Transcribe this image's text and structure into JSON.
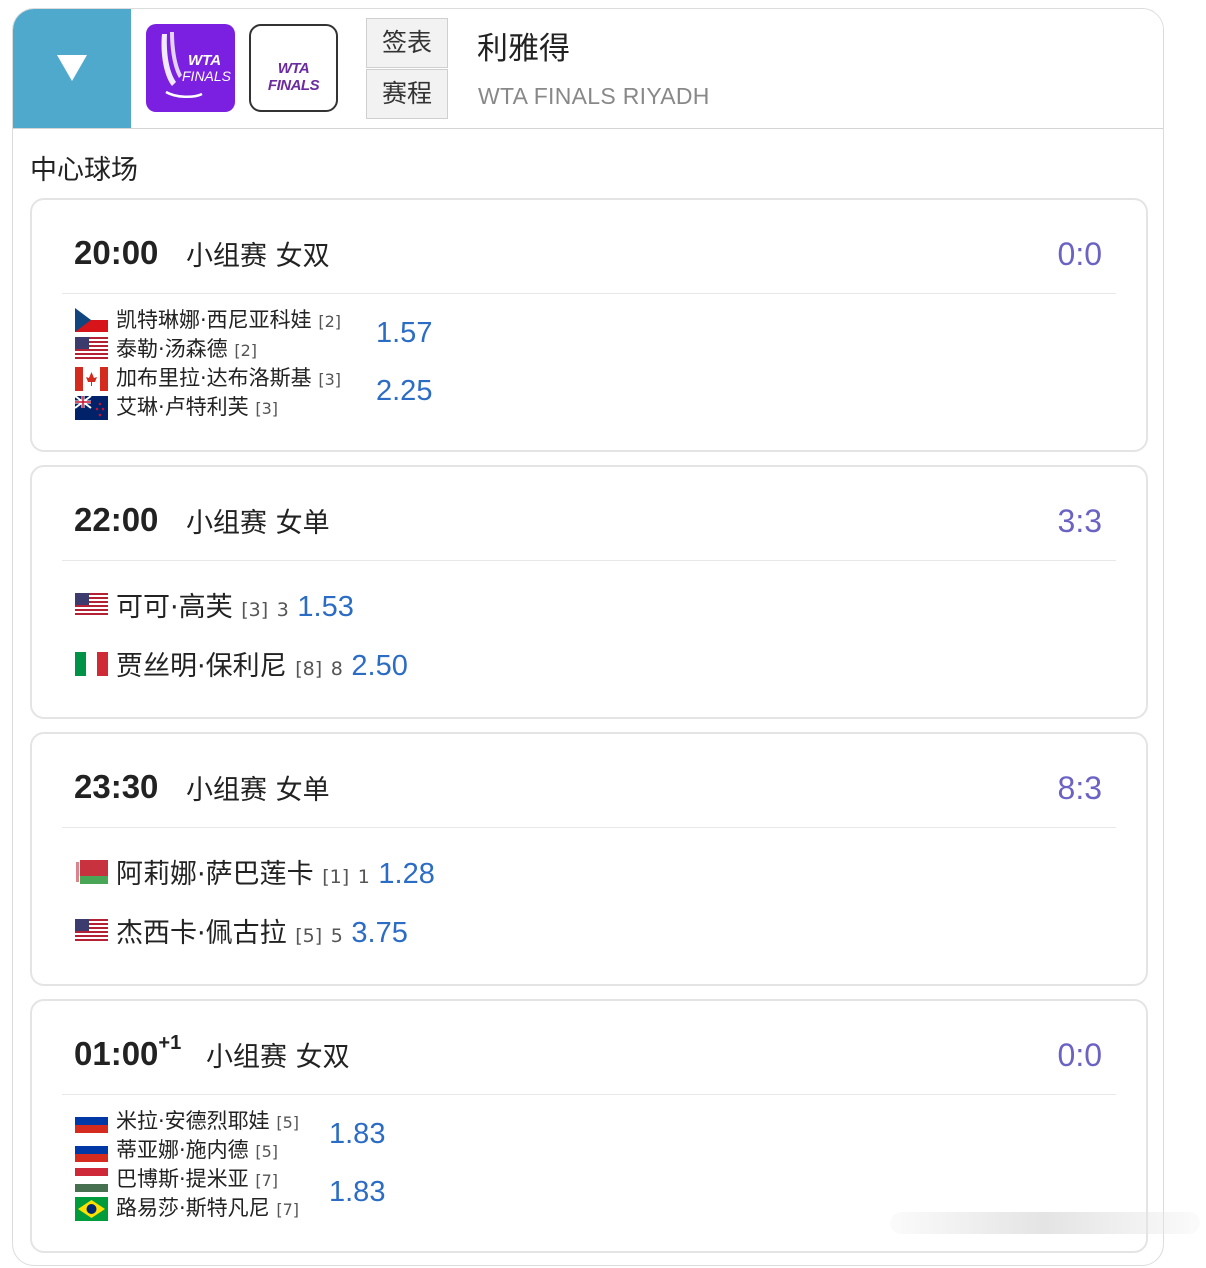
{
  "header": {
    "tabs": [
      "签表",
      "赛程"
    ],
    "venue": "利雅得",
    "venue_en": "WTA FINALS RIYADH",
    "logo1_text": "WTA FINALS",
    "logo2_text": "WTA FINALS"
  },
  "court": "中心球场",
  "matches": [
    {
      "time": "20:00",
      "day_offset": "",
      "round": "小组赛 女双",
      "score": "0:0",
      "players": [
        {
          "name": "凯特琳娜·西尼亚科娃",
          "seed": "[2]",
          "flag": "czech-flag-icon"
        },
        {
          "name": "泰勒·汤森德",
          "seed": "[2]",
          "flag": "usa-flag-icon"
        },
        {
          "name": "加布里拉·达布洛斯基",
          "seed": "[3]",
          "flag": "canada-flag-icon"
        },
        {
          "name": "艾琳·卢特利芙",
          "seed": "[3]",
          "flag": "new-zealand-flag-icon"
        }
      ],
      "odds": [
        "1.57",
        "2.25"
      ]
    },
    {
      "time": "22:00",
      "day_offset": "",
      "round": "小组赛 女单",
      "score": "3:3",
      "players": [
        {
          "name": "可可·高芙",
          "seed": "[3]",
          "rank": "3",
          "flag": "usa-flag-icon"
        },
        {
          "name": "贾丝明·保利尼",
          "seed": "[8]",
          "rank": "8",
          "flag": "italy-flag-icon"
        }
      ],
      "odds": [
        "1.53",
        "2.50"
      ]
    },
    {
      "time": "23:30",
      "day_offset": "",
      "round": "小组赛 女单",
      "score": "8:3",
      "players": [
        {
          "name": "阿莉娜·萨巴莲卡",
          "seed": "[1]",
          "rank": "1",
          "flag": "belarus-flag-icon"
        },
        {
          "name": "杰西卡·佩古拉",
          "seed": "[5]",
          "rank": "5",
          "flag": "usa-flag-icon"
        }
      ],
      "odds": [
        "1.28",
        "3.75"
      ]
    },
    {
      "time": "01:00",
      "day_offset": "+1",
      "round": "小组赛 女双",
      "score": "0:0",
      "players": [
        {
          "name": "米拉·安德烈耶娃",
          "seed": "[5]",
          "flag": "russia-flag-icon"
        },
        {
          "name": "蒂亚娜·施内德",
          "seed": "[5]",
          "flag": "russia-flag-icon"
        },
        {
          "name": "巴博斯·提米亚",
          "seed": "[7]",
          "flag": "hungary-flag-icon"
        },
        {
          "name": "路易莎·斯特凡尼",
          "seed": "[7]",
          "flag": "brazil-flag-icon"
        }
      ],
      "odds": [
        "1.83",
        "1.83"
      ]
    }
  ],
  "colors": {
    "toggle_bg": "#4fa9cd",
    "score": "#6b63c4",
    "odds": "#2b6cc4",
    "logo_purple": "#7b1fe0"
  }
}
